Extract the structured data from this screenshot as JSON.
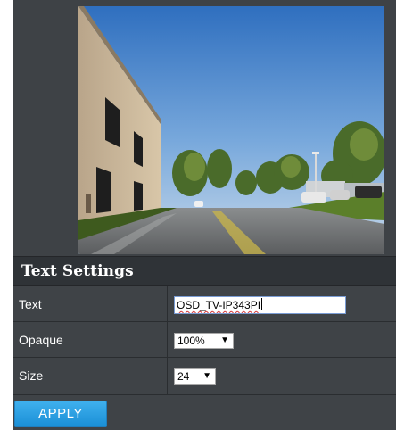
{
  "preview": {
    "image_description_icon": "camera-preview-image"
  },
  "text_settings": {
    "title": "Text Settings",
    "rows": {
      "text": {
        "label": "Text",
        "value": "OSD_TV-IP343PI"
      },
      "opaque": {
        "label": "Opaque",
        "selected": "100%"
      },
      "size": {
        "label": "Size",
        "selected": "24"
      }
    }
  },
  "actions": {
    "apply_label": "APPLY"
  },
  "colors": {
    "panel_bg": "#3e4246",
    "header_bg": "#2f3337",
    "apply_button": "#2aa0e4"
  }
}
